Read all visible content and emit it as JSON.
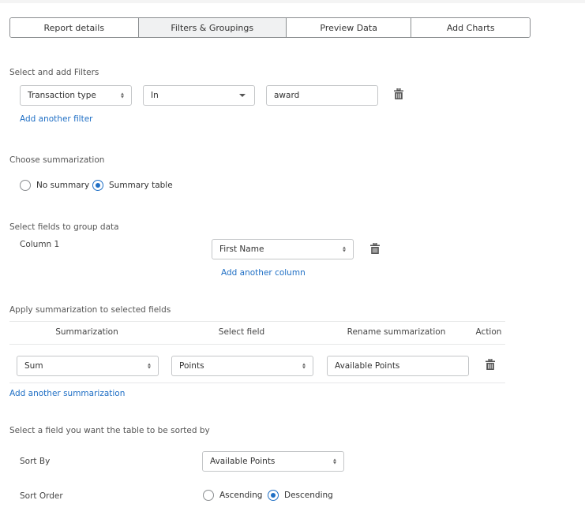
{
  "tabs": [
    {
      "label": "Report details",
      "active": false
    },
    {
      "label": "Filters & Groupings",
      "active": true
    },
    {
      "label": "Preview Data",
      "active": false
    },
    {
      "label": "Add Charts",
      "active": false
    }
  ],
  "filters": {
    "section_label": "Select and add Filters",
    "field_value": "Transaction type",
    "operator_value": "In",
    "value_input": "award",
    "delete_icon": "trash-icon",
    "add_link": "Add another filter"
  },
  "summarization_choice": {
    "section_label": "Choose summarization",
    "options": [
      {
        "label": "No summary",
        "selected": false
      },
      {
        "label": "Summary table",
        "selected": true
      }
    ]
  },
  "grouping": {
    "section_label": "Select fields to group data",
    "column_label": "Column 1",
    "column_value": "First Name",
    "delete_icon": "trash-icon",
    "add_link": "Add another column"
  },
  "summarization_table": {
    "section_label": "Apply summarization to selected fields",
    "headers": [
      "Summarization",
      "Select field",
      "Rename summarization",
      "Action"
    ],
    "rows": [
      {
        "summarization": "Sum",
        "field": "Points",
        "rename": "Available Points",
        "action_icon": "trash-icon"
      }
    ],
    "add_link": "Add another summarization"
  },
  "sorting": {
    "section_label": "Select a field you want the table to be sorted by",
    "sort_by_label": "Sort By",
    "sort_by_value": "Available Points",
    "sort_order_label": "Sort Order",
    "order_options": [
      {
        "label": "Ascending",
        "selected": false
      },
      {
        "label": "Descending",
        "selected": true
      }
    ]
  },
  "colors": {
    "accent": "#1f6fc5",
    "active_tab_bg": "#f0f1f2",
    "border": "#8a8d90"
  }
}
